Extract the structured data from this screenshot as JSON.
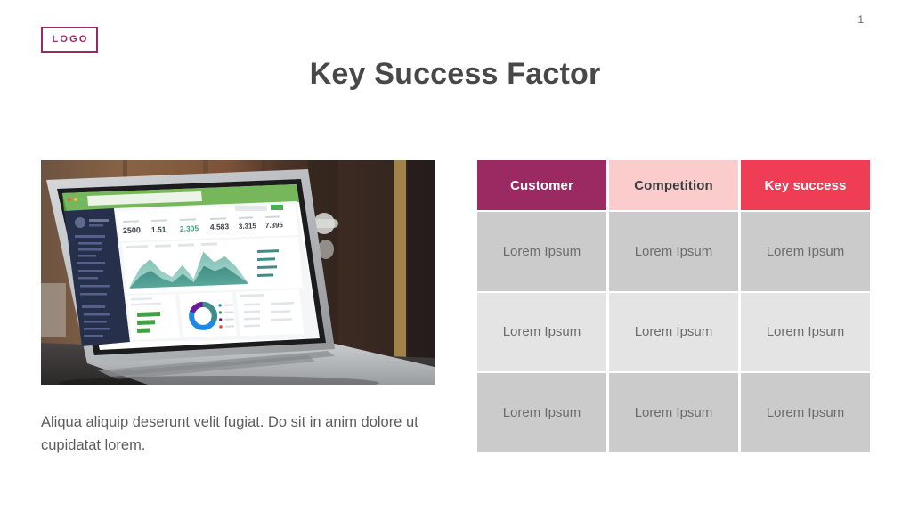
{
  "slide": {
    "page_number": "1",
    "title": "Key Success Factor",
    "logo_label": "LOGO",
    "accent_colors": {
      "logo": "#9B2A62",
      "header_customer": "#9B2A62",
      "header_competition": "#FACCCC",
      "header_key_success": "#EE3D55",
      "row_dark": "#CBCBCB",
      "row_light": "#E4E4E4",
      "title_text": "#484848",
      "body_text": "#5D5D5D"
    }
  },
  "photo": {
    "alt": "laptop-analytics-dashboard-photo",
    "caption": "Aliqua aliquip deserunt velit fugiat. Do sit in anim dolore ut cupidatat lorem.",
    "screen_kpis": [
      "2500",
      "1.51",
      "2.305",
      "4.583",
      "3.315",
      "7.395"
    ]
  },
  "table": {
    "headers": [
      "Customer",
      "Competition",
      "Key success"
    ],
    "rows": [
      [
        "Lorem Ipsum",
        "Lorem Ipsum",
        "Lorem Ipsum"
      ],
      [
        "Lorem Ipsum",
        "Lorem Ipsum",
        "Lorem Ipsum"
      ],
      [
        "Lorem Ipsum",
        "Lorem Ipsum",
        "Lorem Ipsum"
      ]
    ]
  }
}
